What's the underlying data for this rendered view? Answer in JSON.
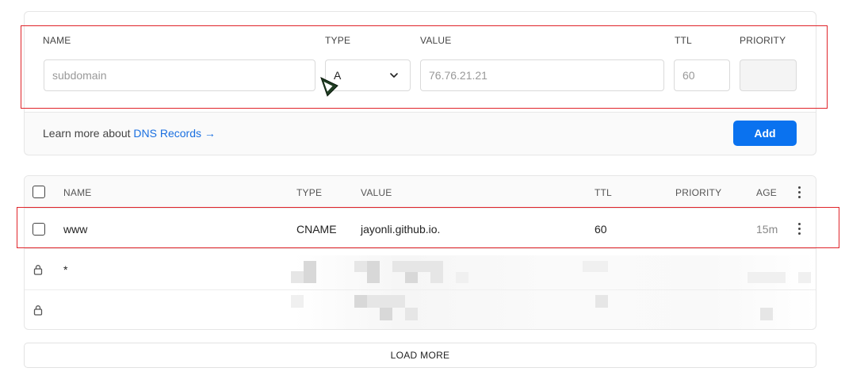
{
  "form": {
    "labels": {
      "name": "NAME",
      "type": "TYPE",
      "value": "VALUE",
      "ttl": "TTL",
      "priority": "PRIORITY"
    },
    "name_placeholder": "subdomain",
    "name_value": "",
    "type_selected": "A",
    "value_value": "76.76.21.21",
    "ttl_value": "60",
    "priority_value": "",
    "learn_prefix": "Learn more about ",
    "learn_link": "DNS Records →",
    "add_label": "Add"
  },
  "table": {
    "headers": {
      "name": "NAME",
      "type": "TYPE",
      "value": "VALUE",
      "ttl": "TTL",
      "priority": "PRIORITY",
      "age": "AGE"
    },
    "rows": [
      {
        "name": "www",
        "type": "CNAME",
        "value": "jayonli.github.io.",
        "ttl": "60",
        "priority": "",
        "age": "15m"
      },
      {
        "name": "*",
        "type": "",
        "value": "",
        "ttl": "",
        "priority": "",
        "age": ""
      },
      {
        "name": "",
        "type": "",
        "value": "",
        "ttl": "",
        "priority": "",
        "age": ""
      }
    ]
  },
  "load_more_label": "LOAD MORE",
  "colors": {
    "accent": "#0a72ef",
    "link": "#1a6fe0",
    "highlight_border": "#e0242a"
  },
  "icons": [
    "chevron-down-icon",
    "lock-icon",
    "more-vertical-icon",
    "checkbox",
    "cursor-icon"
  ]
}
